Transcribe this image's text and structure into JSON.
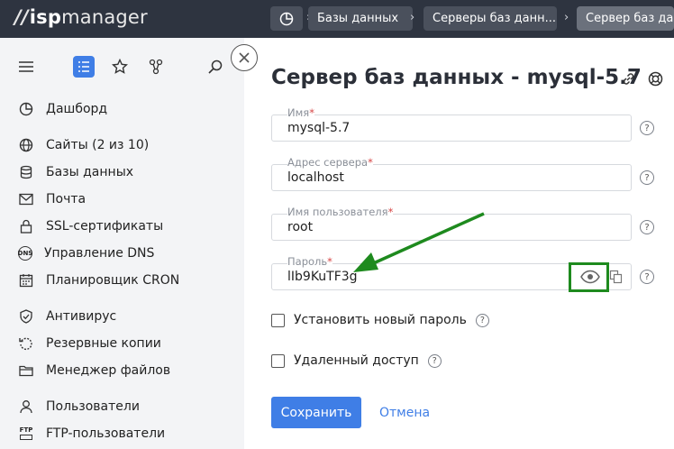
{
  "header": {
    "logo_prefix": "//",
    "logo_bold": "isp",
    "logo_rest": "manager",
    "breadcrumbs": [
      "Базы данных",
      "Серверы баз данн...",
      "Сервер баз данных"
    ]
  },
  "sidebar": {
    "items": [
      {
        "label": "Дашборд",
        "icon": "dashboard-icon"
      },
      {
        "label": "Сайты (2 из 10)",
        "icon": "globe-icon"
      },
      {
        "label": "Базы данных",
        "icon": "database-icon"
      },
      {
        "label": "Почта",
        "icon": "mail-icon"
      },
      {
        "label": "SSL-сертификаты",
        "icon": "lock-icon"
      },
      {
        "label": "Управление DNS",
        "icon": "dns-icon"
      },
      {
        "label": "Планировщик CRON",
        "icon": "calendar-icon"
      },
      {
        "label": "Антивирус",
        "icon": "shield-icon"
      },
      {
        "label": "Резервные копии",
        "icon": "backup-icon"
      },
      {
        "label": "Менеджер файлов",
        "icon": "folder-icon"
      },
      {
        "label": "Пользователи",
        "icon": "user-icon"
      },
      {
        "label": "FTP-пользователи",
        "icon": "ftp-icon"
      }
    ],
    "dns_tag": "DNS",
    "ftp_tag": "FTP"
  },
  "form": {
    "title": "Сервер баз данных - mysql-5.7",
    "name_label": "Имя",
    "name_value": "mysql-5.7",
    "address_label": "Адрес сервера",
    "address_value": "localhost",
    "user_label": "Имя пользователя",
    "user_value": "root",
    "password_label": "Пароль",
    "password_value": "lIb9KuTF3g",
    "required_mark": "*",
    "help_mark": "?",
    "new_password_label": "Установить новый пароль",
    "remote_access_label": "Удаленный доступ",
    "save_label": "Сохранить",
    "cancel_label": "Отмена"
  },
  "colors": {
    "topbar": "#2e3440",
    "accent": "#3f7ee6",
    "highlight": "#1e8a1e",
    "sidebar": "#f3f4f6"
  }
}
